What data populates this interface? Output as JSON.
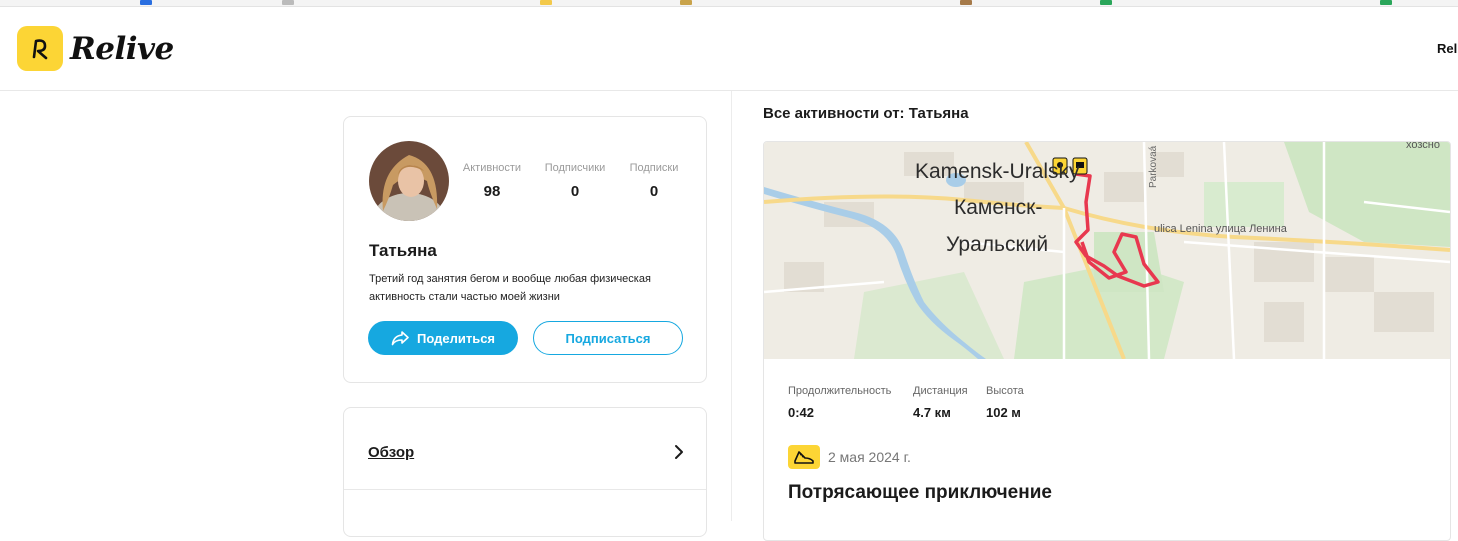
{
  "header": {
    "logo_text": "Relive",
    "right_text": "Rel"
  },
  "profile": {
    "name": "Татьяна",
    "bio": "Третий год занятия бегом и вообще любая физическая активность стали частью моей жизни",
    "stats": [
      {
        "label": "Активности",
        "value": "98"
      },
      {
        "label": "Подписчики",
        "value": "0"
      },
      {
        "label": "Подписки",
        "value": "0"
      }
    ],
    "share_label": "Поделиться",
    "follow_label": "Подписаться"
  },
  "menu": {
    "items": [
      {
        "label": "Обзор"
      }
    ]
  },
  "feed": {
    "title": "Все активности от: Татьяна",
    "activity": {
      "map_labels": {
        "city_latin": "Kamensk-Uralsky",
        "city_ru_1": "Каменск-",
        "city_ru_2": "Уральский",
        "street": "ulica Lenina улица Ленина",
        "side_street": "Parkovaá",
        "corner": "хозсно"
      },
      "metrics": [
        {
          "label": "Продолжительность",
          "value": "0:42"
        },
        {
          "label": "Дистанция",
          "value": "4.7 км"
        },
        {
          "label": "Высота",
          "value": "102 м"
        }
      ],
      "date": "2 мая 2024 г.",
      "title": "Потрясающее приключение",
      "icon": "running-shoe-icon"
    }
  },
  "colors": {
    "brand_yellow": "#fcd535",
    "accent_blue": "#16a8e0",
    "route_red": "#e8384f"
  }
}
